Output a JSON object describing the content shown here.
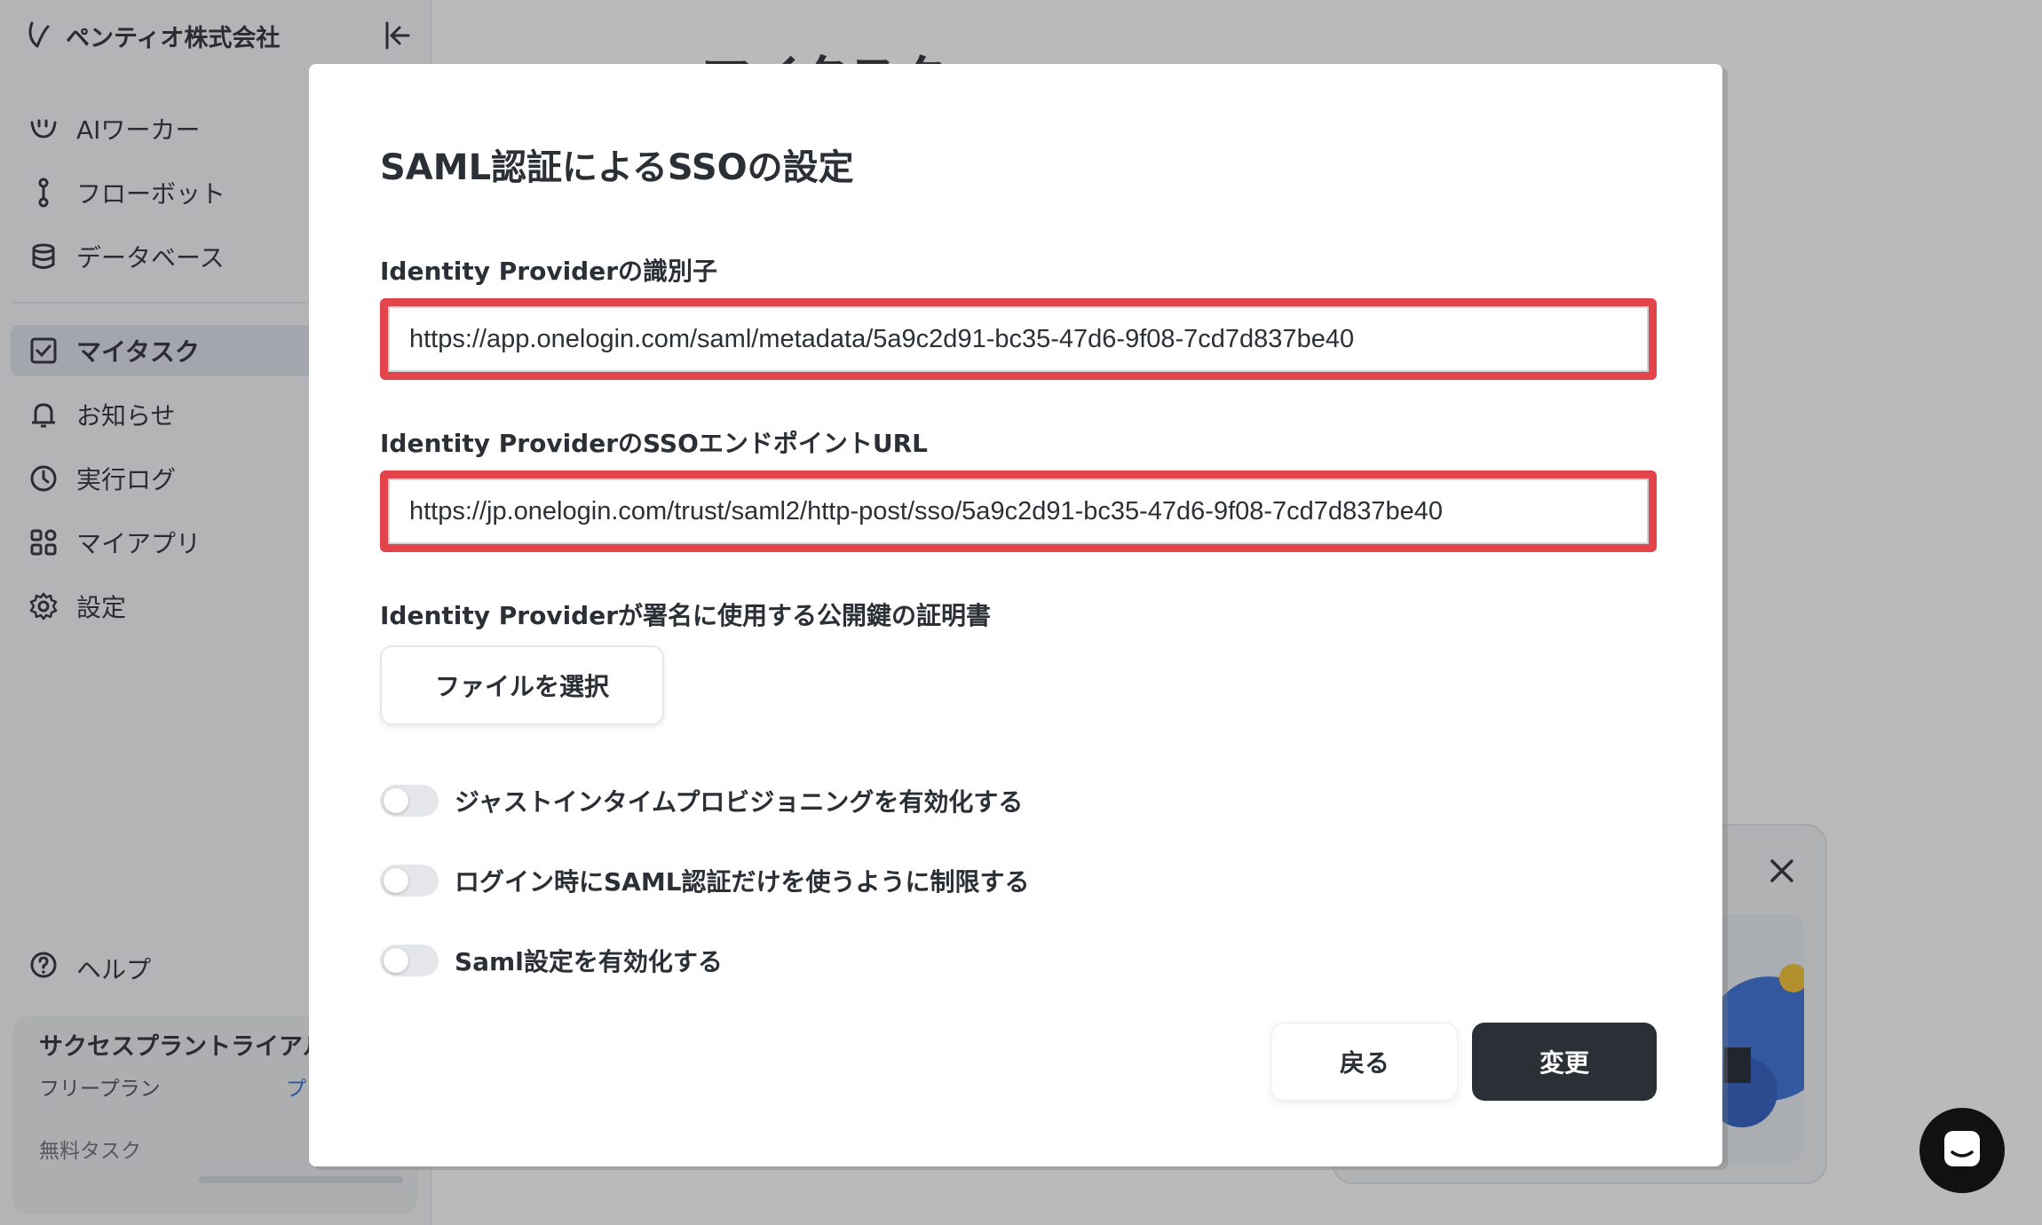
{
  "sidebar": {
    "org_name": "ペンティオ株式会社",
    "items": [
      {
        "label": "AIワーカー",
        "icon": "ai-worker-icon"
      },
      {
        "label": "フローボット",
        "icon": "flowbot-icon"
      },
      {
        "label": "データベース",
        "icon": "database-icon"
      },
      {
        "label": "マイタスク",
        "icon": "checkbox-icon",
        "active": true
      },
      {
        "label": "お知らせ",
        "icon": "bell-icon"
      },
      {
        "label": "実行ログ",
        "icon": "clock-icon"
      },
      {
        "label": "マイアプリ",
        "icon": "apps-icon"
      },
      {
        "label": "設定",
        "icon": "gear-icon"
      }
    ],
    "help_label": "ヘルプ",
    "plan": {
      "title": "サクセスプラントライアル",
      "subtitle": "フリープラン",
      "link": "プ",
      "free_tasks": "無料タスク"
    }
  },
  "main": {
    "title": "マイタスク"
  },
  "modal": {
    "title": "SAML認証によるSSOの設定",
    "idp_identifier": {
      "label": "Identity Providerの識別子",
      "value": "https://app.onelogin.com/saml/metadata/5a9c2d91-bc35-47d6-9f08-7cd7d837be40"
    },
    "idp_sso_url": {
      "label": "Identity ProviderのSSOエンドポイントURL",
      "value": "https://jp.onelogin.com/trust/saml2/http-post/sso/5a9c2d91-bc35-47d6-9f08-7cd7d837be40"
    },
    "certificate": {
      "label": "Identity Providerが署名に使用する公開鍵の証明書",
      "button_label": "ファイルを選択"
    },
    "toggles": [
      {
        "label": "ジャストインタイムプロビジョニングを有効化する",
        "enabled": false
      },
      {
        "label": "ログイン時にSAML認証だけを使うように制限する",
        "enabled": false
      },
      {
        "label": "Saml設定を有効化する",
        "enabled": false
      }
    ],
    "back_label": "戻る",
    "submit_label": "変更"
  },
  "colors": {
    "highlight_border": "#e3444a",
    "primary_button": "#2b2f36",
    "overlay": "rgba(40,40,40,0.32)"
  }
}
